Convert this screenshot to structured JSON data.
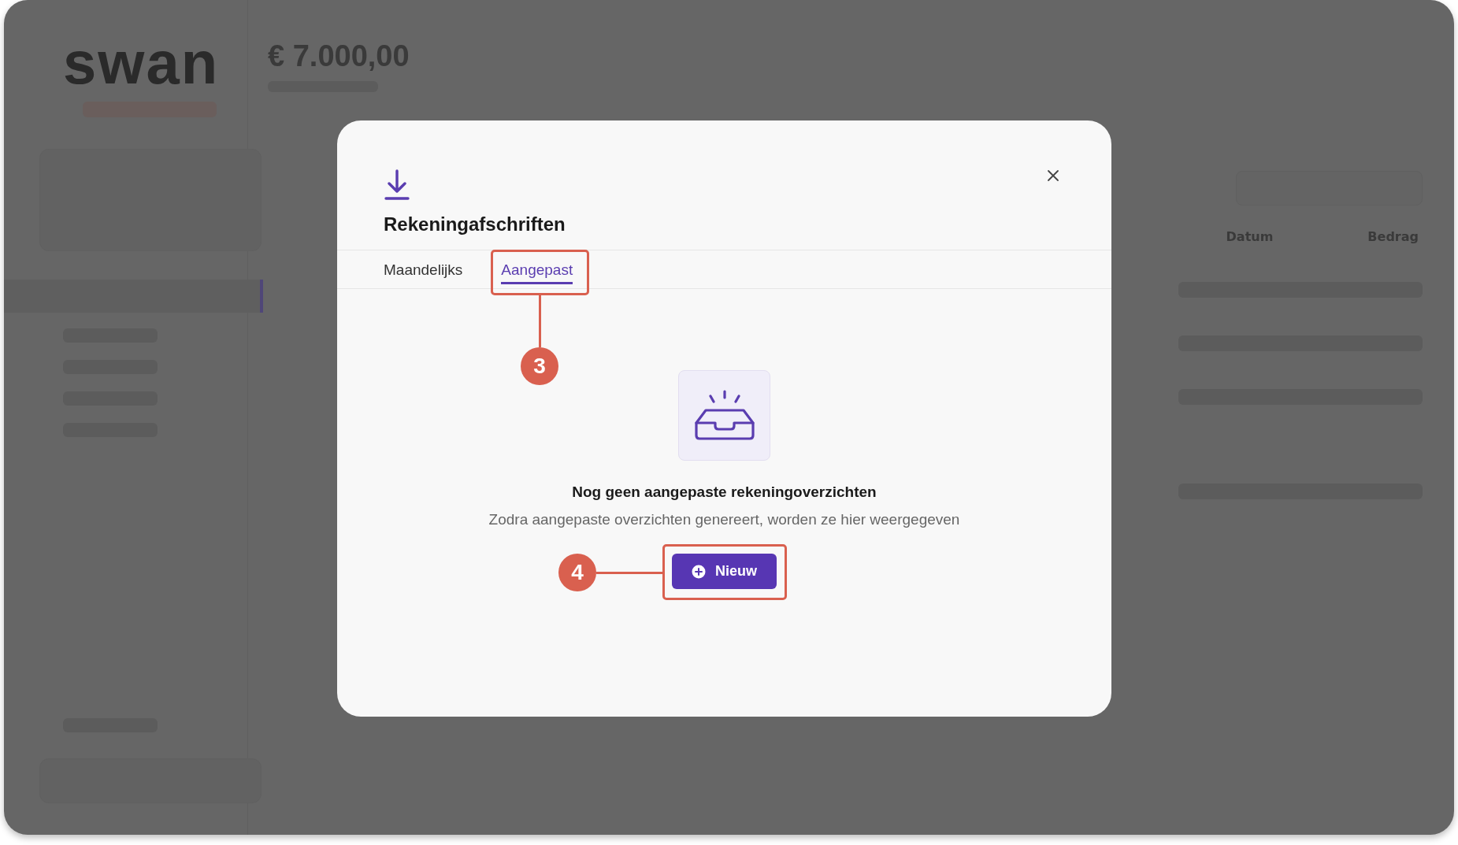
{
  "app": {
    "logo": "swan",
    "balance": "€ 7.000,00",
    "table": {
      "columns": [
        "Datum",
        "Bedrag"
      ]
    }
  },
  "modal": {
    "title": "Rekeningafschriften",
    "tabs": [
      {
        "label": "Maandelijks",
        "selected": false
      },
      {
        "label": "Aangepast",
        "selected": true
      }
    ],
    "empty_state": {
      "heading": "Nog geen aangepaste rekeningoverzichten",
      "text": "Zodra aangepaste overzichten genereert, worden ze hier weergegeven"
    },
    "button": {
      "label": "Nieuw"
    }
  },
  "annotations": [
    {
      "number": "3",
      "kind": "tab"
    },
    {
      "number": "4",
      "kind": "button"
    }
  ]
}
